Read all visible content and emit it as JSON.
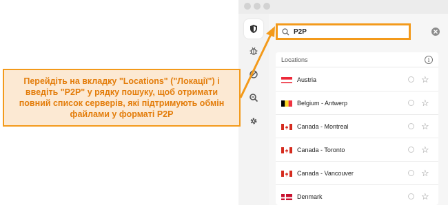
{
  "callout": {
    "text": "Перейдіть на вкладку \"Locations\" (\"Локації\") і введіть \"P2P\" у рядку пошуку, щоб отримати повний список серверів, які підтримують обмін файлами у форматі P2P"
  },
  "sidebar": {
    "items": [
      {
        "icon": "shield-icon"
      },
      {
        "icon": "bug-icon"
      },
      {
        "icon": "block-icon"
      },
      {
        "icon": "magnifier-icon"
      },
      {
        "icon": "gear-icon"
      }
    ]
  },
  "search": {
    "value": "P2P",
    "icon": "search-icon"
  },
  "list": {
    "header": "Locations",
    "rows": [
      {
        "label": "Austria",
        "flag": "austria"
      },
      {
        "label": "Belgium - Antwerp",
        "flag": "belgium"
      },
      {
        "label": "Canada - Montreal",
        "flag": "canada"
      },
      {
        "label": "Canada - Toronto",
        "flag": "canada"
      },
      {
        "label": "Canada - Vancouver",
        "flag": "canada"
      },
      {
        "label": "Denmark",
        "flag": "denmark"
      }
    ]
  },
  "colors": {
    "accent": "#f39a1b",
    "callout_bg": "#fce9d3",
    "callout_text": "#e37d0b"
  }
}
